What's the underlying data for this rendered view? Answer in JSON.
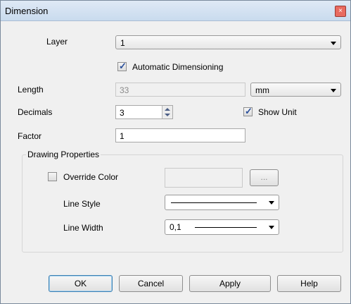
{
  "window": {
    "title": "Dimension",
    "close_glyph": "×"
  },
  "layer": {
    "label": "Layer",
    "value": "1"
  },
  "auto_dim": {
    "label": "Automatic Dimensioning",
    "checked": true
  },
  "length": {
    "label": "Length",
    "value": "33",
    "unit": "mm"
  },
  "decimals": {
    "label": "Decimals",
    "value": "3"
  },
  "show_unit": {
    "label": "Show Unit",
    "checked": true
  },
  "factor": {
    "label": "Factor",
    "value": "1"
  },
  "drawing_properties": {
    "title": "Drawing Properties",
    "override_color": {
      "label": "Override Color",
      "checked": false,
      "browse_label": "..."
    },
    "line_style": {
      "label": "Line Style"
    },
    "line_width": {
      "label": "Line Width",
      "value": "0,1"
    }
  },
  "buttons": {
    "ok": "OK",
    "cancel": "Cancel",
    "apply": "Apply",
    "help": "Help"
  },
  "colors": {
    "titlebar": "#c9dbee",
    "check": "#2a4f9a",
    "close": "#e86a5f"
  }
}
